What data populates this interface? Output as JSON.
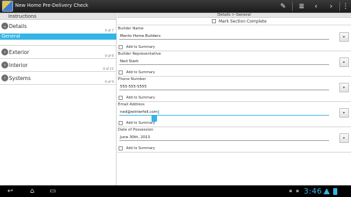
{
  "app": {
    "title": "New Home Pre-Delivery Check"
  },
  "left": {
    "header": "Instructions",
    "sections": [
      {
        "label": "Details",
        "count": "",
        "expanded": true,
        "subitem": "General",
        "subcount": "0 of 7"
      },
      {
        "label": "Exterior",
        "count": "0 of 6"
      },
      {
        "label": "Interior",
        "count": "0 of 11"
      },
      {
        "label": "Systems",
        "count": "0 of 9"
      }
    ]
  },
  "right": {
    "breadcrumb": "Details > General",
    "mark_label": "Mark Section Complete",
    "fields": [
      {
        "label": "Builder Name",
        "value": "Mento Home Builders",
        "add_label": "Add to Summary"
      },
      {
        "label": "Builder Representative",
        "value": "Ned Stark",
        "add_label": "Add to Summary"
      },
      {
        "label": "Phone Number",
        "value": "555-555-5555",
        "add_label": "Add to Summary"
      },
      {
        "label": "Email Address",
        "value": "ned@winterfell.com",
        "add_label": "Add to Summary"
      },
      {
        "label": "Date of Possession",
        "value": "June 30th, 2013",
        "add_label": "Add to Summary"
      }
    ],
    "arrow_symbol": "▸"
  },
  "toolbar": {
    "icons": [
      "edit-icon",
      "list-icon",
      "back-arrow-icon",
      "forward-arrow-icon",
      "overflow-menu-icon"
    ],
    "glyphs": [
      "✎",
      "≣",
      "‹",
      "›",
      "⋮"
    ]
  },
  "system": {
    "time": "3:46",
    "nav_glyphs": [
      "↩",
      "⌂",
      "▭"
    ],
    "accent": "#33b5e5"
  }
}
